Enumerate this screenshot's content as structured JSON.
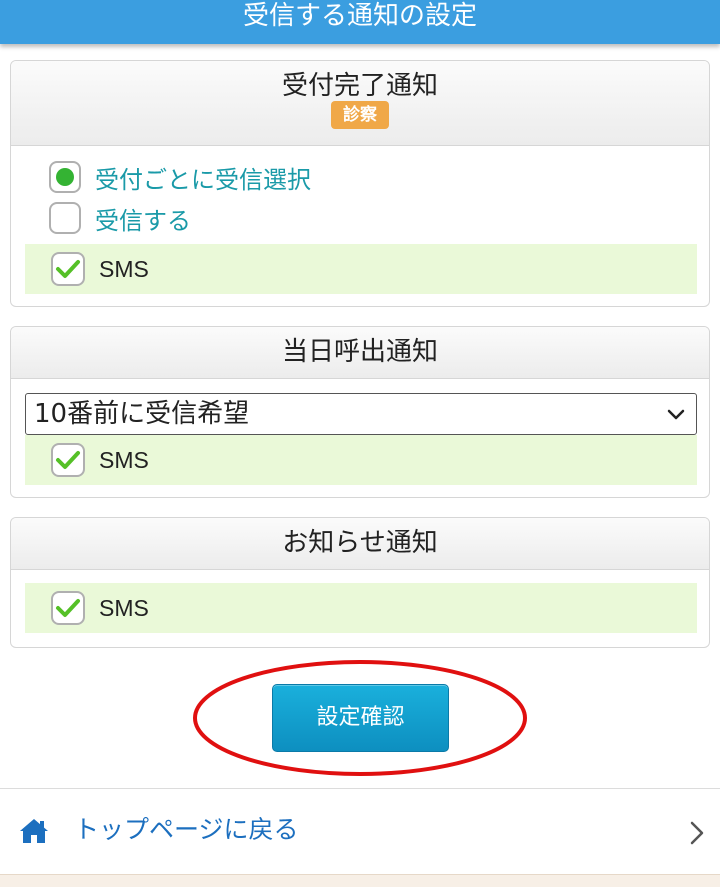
{
  "header": {
    "title": "受信する通知の設定"
  },
  "sections": {
    "reception": {
      "title": "受付完了通知",
      "badge": "診察",
      "options": [
        {
          "label": "受付ごとに受信選択",
          "selected": true
        },
        {
          "label": "受信する",
          "selected": false
        }
      ],
      "sms": {
        "label": "SMS",
        "checked": true
      }
    },
    "same_day": {
      "title": "当日呼出通知",
      "select_value": "10番前に受信希望",
      "sms": {
        "label": "SMS",
        "checked": true
      }
    },
    "notice": {
      "title": "お知らせ通知",
      "sms": {
        "label": "SMS",
        "checked": true
      }
    }
  },
  "actions": {
    "confirm_label": "設定確認"
  },
  "footer": {
    "top_link_label": "トップページに戻る"
  },
  "colors": {
    "header_bg": "#3b9ee0",
    "badge_bg": "#f0a848",
    "radio_selected": "#34b333",
    "option_text": "#1a9aa8",
    "sms_row_bg": "#eaf9d8",
    "check_mark": "#55c027",
    "button_bg": "#1ab0dc",
    "highlight": "#e01010",
    "link_text": "#1c6fbf"
  },
  "icons": {
    "home": "home-icon",
    "chevron": "chevron-right-icon",
    "check": "check-icon",
    "select_arrow": "chevron-down-icon"
  }
}
